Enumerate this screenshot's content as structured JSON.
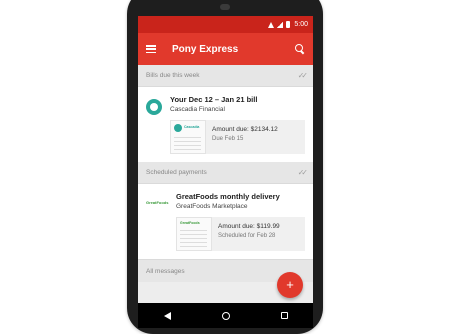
{
  "status_bar": {
    "time": "5:00"
  },
  "app_bar": {
    "title": "Pony Express"
  },
  "sections": [
    {
      "header": "Bills due this week",
      "card": {
        "logo": "cascadia-logo",
        "title": "Your Dec 12 – Jan 21 bill",
        "subtitle": "Cascadia Financial",
        "preview_brand": "Cascadia",
        "amount": "Amount due: $2134.12",
        "due": "Due Feb 15"
      }
    },
    {
      "header": "Scheduled payments",
      "card": {
        "logo_text": "GreatFoods",
        "title": "GreatFoods monthly delivery",
        "subtitle": "GreatFoods Marketplace",
        "preview_brand": "GreatFoods",
        "amount": "Amount due: $119.99",
        "due": "Scheduled for Feb 28"
      }
    }
  ],
  "footer_section": "All messages",
  "fab": {
    "label": "+"
  },
  "colors": {
    "primary": "#e1392c",
    "status_bar": "#c9241b"
  }
}
